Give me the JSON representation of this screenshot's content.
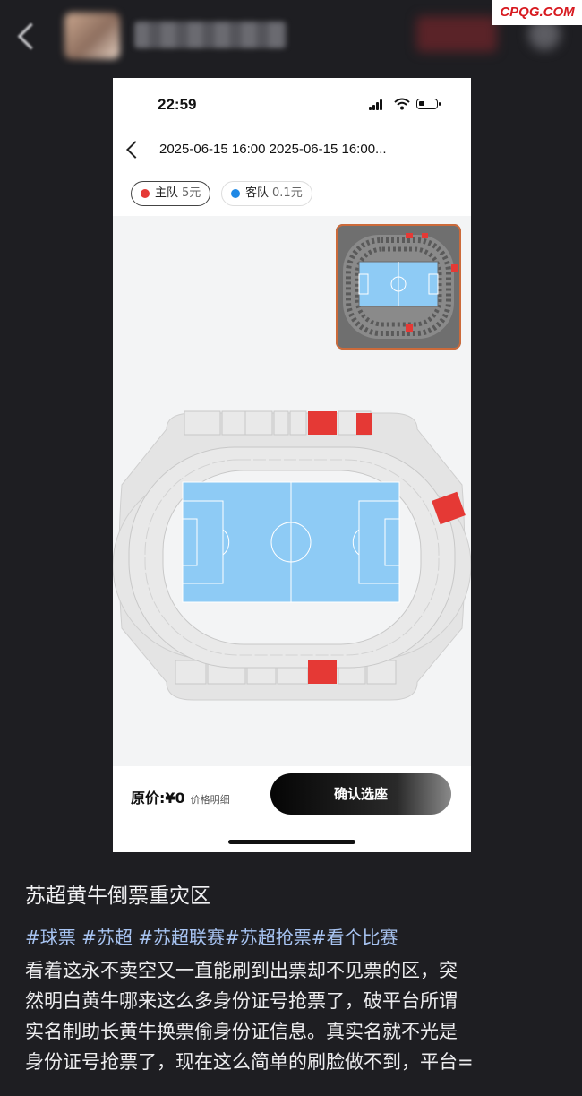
{
  "watermark": "CPQG.COM",
  "phone": {
    "status_time": "22:59",
    "nav_title": "2025-06-15 16:00 2025-06-15 16:00...",
    "price_tags": [
      {
        "label": "主队",
        "price": "5元",
        "color": "#e53935"
      },
      {
        "label": "客队",
        "price": "0.1元",
        "color": "#1e88e5"
      }
    ],
    "original_price_label": "原价:",
    "original_price_value": "¥0",
    "price_detail_label": "价格明细",
    "confirm_label": "确认选座",
    "colors": {
      "pitch": "#8ecbf5",
      "selected_section": "#e53935",
      "section": "#e6e6e6"
    }
  },
  "post": {
    "title": "苏超黄牛倒票重灾区",
    "hashtags": "#球票 #苏超 #苏超联赛#苏超抢票#看个比赛",
    "body_lines": [
      "看着这永不卖空又一直能刷到出票却不见票的区，突",
      "然明白黄牛哪来这么多身份证号抢票了，破平台所谓",
      "实名制助长黄牛换票偷身份证信息。真实名就不光是",
      "身份证号抢票了，现在这么简单的刷脸做不到，平台="
    ]
  }
}
